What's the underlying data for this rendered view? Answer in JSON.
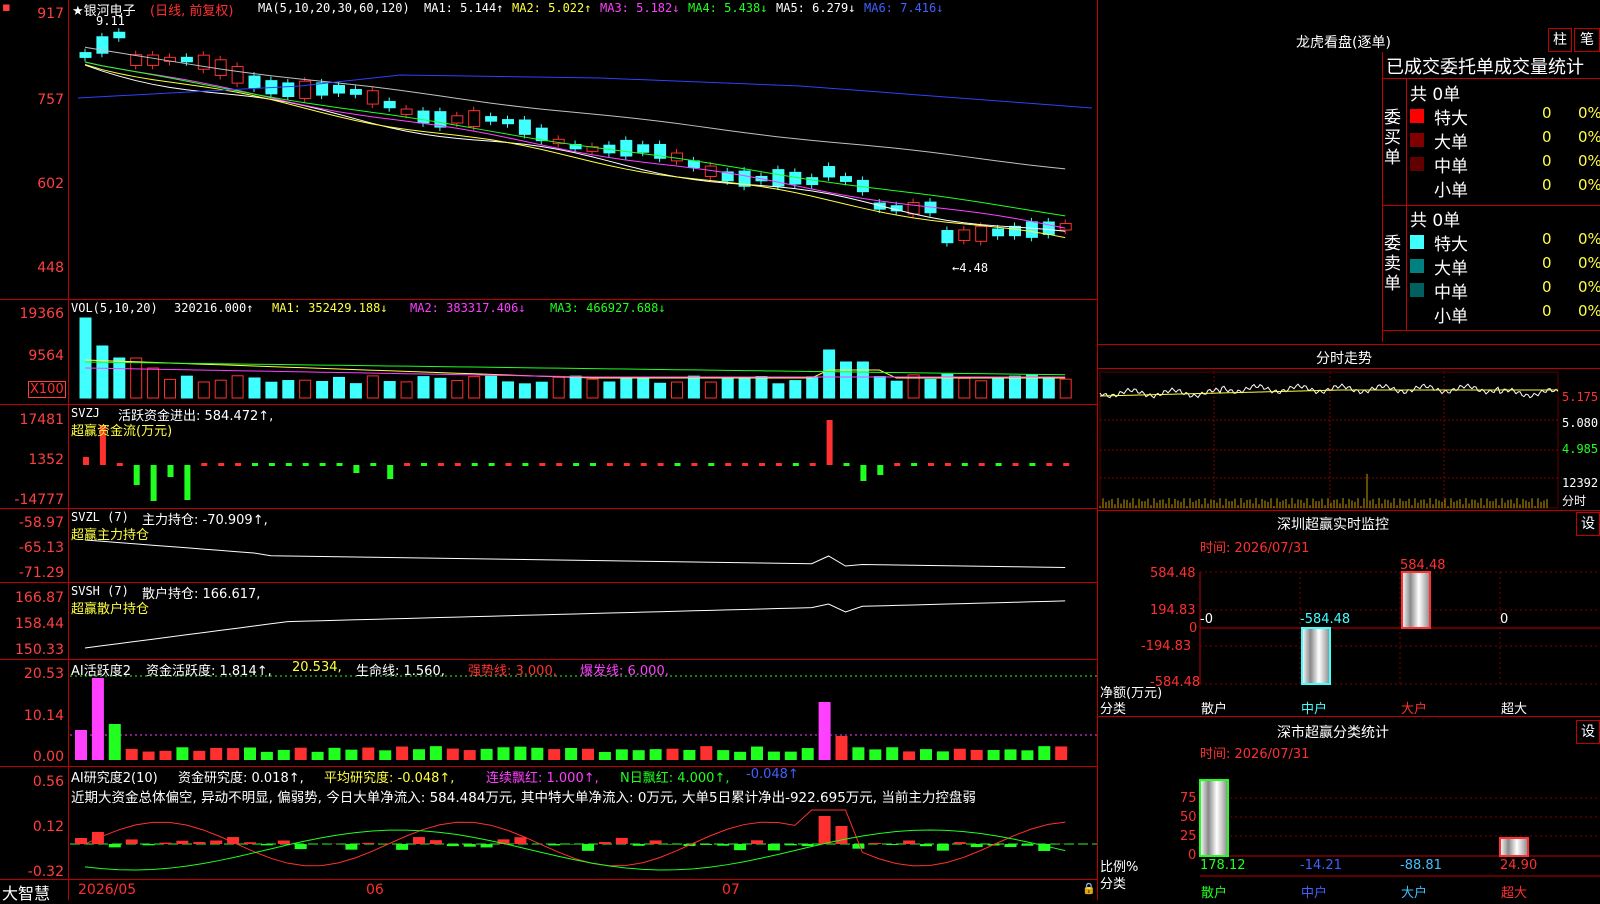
{
  "stock": {
    "name": "★银河电子",
    "mode": "(日线, 前复权)",
    "ma_header": "MA(5,10,20,30,60,120)",
    "ma1": "MA1: 5.144↑",
    "ma2": "MA2: 5.022↑",
    "ma3": "MA3: 5.182↓",
    "ma4": "MA4: 5.438↓",
    "ma5": "MA5: 6.279↓",
    "ma6": "MA6: 7.416↓",
    "high_marker": "9.11",
    "low_marker": "←4.48"
  },
  "price_axis": [
    "917",
    "757",
    "602",
    "448"
  ],
  "vol": {
    "header": "VOL(5,10,20)",
    "value": "320216.000↑",
    "ma1": "MA1: 352429.188↓",
    "ma2": "MA2: 383317.406↓",
    "ma3": "MA3: 466927.688↓",
    "axis": [
      "19366",
      "9564",
      "X100"
    ]
  },
  "svzj": {
    "header": "SVZJ",
    "value": "活跃资金进出: 584.472↑,",
    "subtitle": "超赢资金流(万元)",
    "axis": [
      "17481",
      "1352",
      "-14777"
    ]
  },
  "svzl": {
    "header": "SVZL (7)",
    "value": "主力持仓: -70.909↑,",
    "subtitle": "超赢主力持仓",
    "axis": [
      "-58.97",
      "-65.13",
      "-71.29"
    ]
  },
  "svsh": {
    "header": "SVSH (7)",
    "value": "散户持仓: 166.617,",
    "subtitle": "超赢散户持仓",
    "axis": [
      "166.87",
      "158.44",
      "150.33"
    ]
  },
  "ai_active": {
    "header": "AI活跃度2",
    "value1": "资金活跃度: 1.814↑,",
    "value2": "20.534,",
    "value3": "生命线: 1.560,",
    "value4": "强势线: 3.000,",
    "value5": "爆发线: 6.000,",
    "axis": [
      "20.53",
      "10.14",
      "0.00"
    ]
  },
  "ai_research": {
    "header": "AI研究度2(10)",
    "value1": "资金研究度: 0.018↑,",
    "value2": "平均研究度: -0.048↑,",
    "value3": "连续飘红: 1.000↑,",
    "value4": "N日飘红: 4.000↑,",
    "value5": "-0.048↑",
    "comment": "近期大资金总体偏空, 异动不明显, 偏弱势, 今日大单净流入: 584.484万元, 其中特大单净流入: 0万元, 大单5日累计净出-922.695万元, 当前主力控盘弱",
    "axis": [
      "0.56",
      "0.12",
      "-0.32"
    ]
  },
  "date_axis": [
    "2026/05",
    "06",
    "07"
  ],
  "brand": "大智慧",
  "longhu": {
    "title": "龙虎看盘(逐单)",
    "btn1": "柱",
    "btn2": "笔",
    "stats_title": "已成交委托单成交量统计",
    "buy_label": "委买单",
    "sell_label": "委卖单",
    "buy_total": "共 0单",
    "sell_total": "共 0单",
    "rows": [
      "特大",
      "大单",
      "中单",
      "小单"
    ],
    "zero": "0",
    "pct": "0%",
    "buy_colors": [
      "#ff0000",
      "#800000",
      "#600000",
      ""
    ],
    "sell_colors": [
      "#40ffff",
      "#008080",
      "#006060",
      ""
    ]
  },
  "fenshi": {
    "title": "分时走势",
    "axis": [
      "5.175",
      "5.080",
      "4.985",
      "12392",
      "分时"
    ]
  },
  "monitor": {
    "title": "深圳超赢实时监控",
    "btn": "设",
    "time": "时间: 2026/07/31",
    "axis": [
      "584.48",
      "194.83",
      "0",
      "-194.83",
      "-584.48"
    ],
    "values": [
      "-0",
      "-584.48",
      "584.48",
      "0"
    ],
    "label1": "净额(万元)",
    "label2": "分类",
    "cats": [
      "散户",
      "中户",
      "大户",
      "超大"
    ]
  },
  "classify": {
    "title": "深市超赢分类统计",
    "btn": "设",
    "time": "时间: 2026/07/31",
    "axis": [
      "75",
      "50",
      "25",
      "0"
    ],
    "values": [
      "178.12",
      "-14.21",
      "-88.81",
      "24.90"
    ],
    "label1": "比例%",
    "label2": "分类",
    "cats": [
      "散户",
      "中户",
      "大户",
      "超大"
    ]
  }
}
